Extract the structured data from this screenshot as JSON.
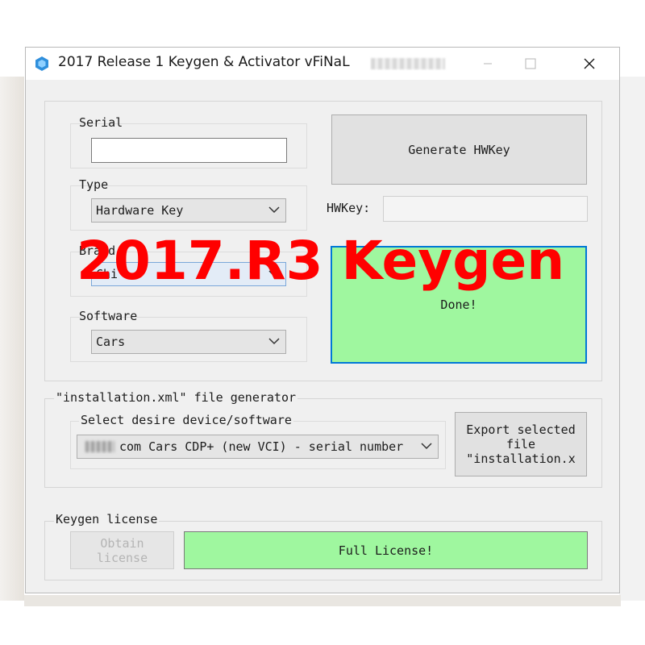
{
  "window": {
    "title": "2017 Release 1 Keygen & Activator vFiNaL",
    "minimize_icon": "minimize-icon",
    "maximize_icon": "maximize-icon",
    "close_icon": "close-icon"
  },
  "left_panel": {
    "serial_label": "Serial",
    "serial_value": "",
    "type_label": "Type",
    "type_value": "Hardware Key",
    "brand_label": "Brand",
    "brand_value": "Chi",
    "software_label": "Software",
    "software_value": "Cars"
  },
  "right_panel": {
    "generate_button": "Generate HWKey",
    "hwkey_label": "HWKey:",
    "hwkey_value": "",
    "status_text": "Done!"
  },
  "installation": {
    "group_label": "\"installation.xml\" file generator",
    "select_label": "Select desire device/software",
    "select_value": "com Cars CDP+ (new VCI) - serial number",
    "export_button": "Export selected file \"installation.x"
  },
  "license": {
    "group_label": "Keygen license",
    "obtain_button": "Obtain license",
    "status_text": "Full License!"
  },
  "overlay_text": "2017.R3 Keygen",
  "colors": {
    "success_green": "#9ff79f",
    "focus_blue": "#0078d7",
    "overlay_red": "#ff0000"
  }
}
